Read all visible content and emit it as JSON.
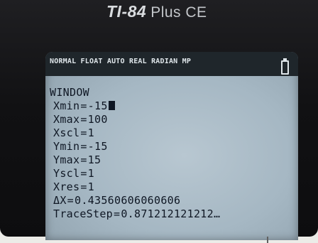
{
  "device": {
    "model": "TI-84",
    "suffix": "Plus CE"
  },
  "status_bar": {
    "text": "NORMAL FLOAT AUTO REAL RADIAN MP",
    "battery_icon": "battery-icon"
  },
  "window_menu": {
    "title": "WINDOW",
    "rows": [
      {
        "name": "Xmin",
        "value": "-15",
        "cursor": true
      },
      {
        "name": "Xmax",
        "value": "100"
      },
      {
        "name": "Xscl",
        "value": "1"
      },
      {
        "name": "Ymin",
        "value": "-15"
      },
      {
        "name": "Ymax",
        "value": "15"
      },
      {
        "name": "Yscl",
        "value": "1"
      },
      {
        "name": "Xres",
        "value": "1"
      },
      {
        "name": "ΔX",
        "value": "0.43560606060606"
      },
      {
        "name": "TraceStep",
        "value": "0.871212121212",
        "ellipsis": "…"
      }
    ]
  },
  "colors": {
    "screen": "#a5b7c3",
    "status_bar": "#1f262b",
    "text": "#0f1724",
    "bezel": "#111113"
  }
}
